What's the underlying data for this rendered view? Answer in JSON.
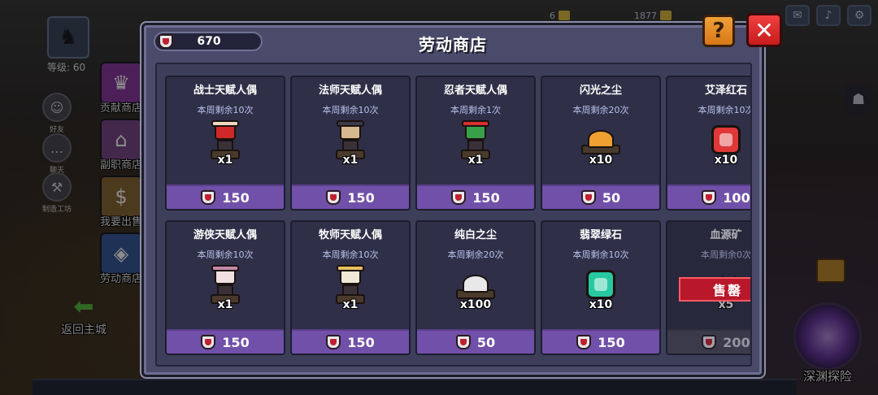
{
  "background": {
    "player_level": "等级: 60",
    "resources": [
      {
        "value": "6",
        "color": "#e0c040"
      },
      {
        "value": "1877",
        "color": "#e0c040"
      }
    ],
    "left_icons": [
      {
        "label": "好友",
        "icon": "friends-icon"
      },
      {
        "label": "聊天",
        "icon": "chat-icon"
      },
      {
        "label": "制造工坊",
        "icon": "anvil-icon"
      }
    ],
    "side_menu": [
      {
        "label": "贡献商店",
        "icon": "contribution-shop-icon",
        "color": "#8a3aa0"
      },
      {
        "label": "副职商店",
        "icon": "profession-shop-icon",
        "color": "#7a4a8a"
      },
      {
        "label": "我要出售",
        "icon": "sell-icon",
        "color": "#8a6a3a"
      },
      {
        "label": "劳动商店",
        "icon": "labor-shop-icon",
        "color": "#3a5a9a"
      }
    ],
    "back_label": "返回主城",
    "abyss_label": "深渊探险"
  },
  "modal": {
    "title": "劳动商店",
    "currency": "670",
    "help_label": "?",
    "close_label": "✕",
    "soldout_label": "售罄",
    "items": [
      {
        "name": "战士天赋人偶",
        "remain": "本周剩余10次",
        "qty": "x1",
        "price": "150",
        "art": "doll",
        "head": "#d02828",
        "hat": "#f0d8c0",
        "soldout": false
      },
      {
        "name": "法师天赋人偶",
        "remain": "本周剩余10次",
        "qty": "x1",
        "price": "150",
        "art": "doll",
        "head": "#d8b890",
        "hat": "#3a3a48",
        "soldout": false
      },
      {
        "name": "忍者天赋人偶",
        "remain": "本周剩余1次",
        "qty": "x1",
        "price": "150",
        "art": "doll",
        "head": "#38a048",
        "hat": "#d83030",
        "soldout": false
      },
      {
        "name": "闪光之尘",
        "remain": "本周剩余20次",
        "qty": "x10",
        "price": "50",
        "art": "dust",
        "color": "#f0a030",
        "soldout": false
      },
      {
        "name": "艾泽红石",
        "remain": "本周剩余10次",
        "qty": "x10",
        "price": "100",
        "art": "gem",
        "color": "#e03838",
        "soldout": false
      },
      {
        "name": "游侠天赋人偶",
        "remain": "本周剩余10次",
        "qty": "x1",
        "price": "150",
        "art": "doll",
        "head": "#f0e0e0",
        "hat": "#c888a8",
        "soldout": false
      },
      {
        "name": "牧师天赋人偶",
        "remain": "本周剩余10次",
        "qty": "x1",
        "price": "150",
        "art": "doll",
        "head": "#f0e8d8",
        "hat": "#e8c060",
        "soldout": false
      },
      {
        "name": "纯白之尘",
        "remain": "本周剩余20次",
        "qty": "x100",
        "price": "50",
        "art": "dust",
        "color": "#e8e8e8",
        "soldout": false
      },
      {
        "name": "翡翠绿石",
        "remain": "本周剩余10次",
        "qty": "x10",
        "price": "150",
        "art": "gem",
        "color": "#28c8a0",
        "soldout": false
      },
      {
        "name": "血源矿",
        "remain": "本周剩余0次",
        "qty": "x5",
        "price": "200",
        "art": "ore",
        "color": "#a0202a",
        "soldout": true
      }
    ]
  }
}
